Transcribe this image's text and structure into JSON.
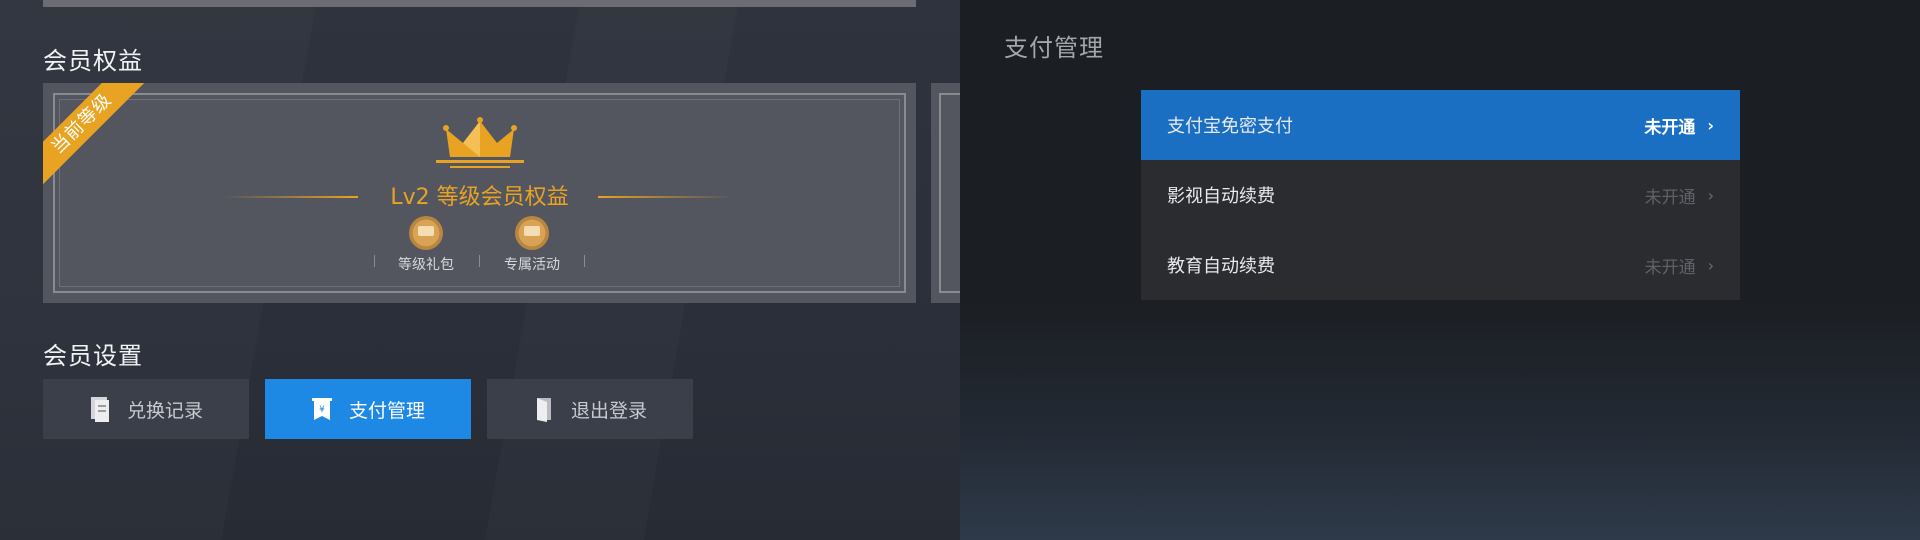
{
  "left": {
    "section_benefits": "会员权益",
    "section_settings": "会员设置",
    "card": {
      "ribbon": "当前等级",
      "level_title": "Lv2 等级会员权益",
      "perks": [
        {
          "label": "等级礼包",
          "icon": "gift-badge-icon"
        },
        {
          "label": "专属活动",
          "icon": "event-badge-icon"
        }
      ]
    },
    "buttons": [
      {
        "label": "兑换记录",
        "icon": "document-icon",
        "active": false
      },
      {
        "label": "支付管理",
        "icon": "payment-icon",
        "active": true
      },
      {
        "label": "退出登录",
        "icon": "door-icon",
        "active": false
      }
    ]
  },
  "right": {
    "title": "支付管理",
    "rows": [
      {
        "name": "支付宝免密支付",
        "status": "未开通",
        "active": true
      },
      {
        "name": "影视自动续费",
        "status": "未开通",
        "active": false
      },
      {
        "name": "教育自动续费",
        "status": "未开通",
        "active": false
      }
    ]
  },
  "colors": {
    "accent_blue": "#1e88e5",
    "row_active": "#1b6fc2",
    "gold": "#e8a322"
  }
}
